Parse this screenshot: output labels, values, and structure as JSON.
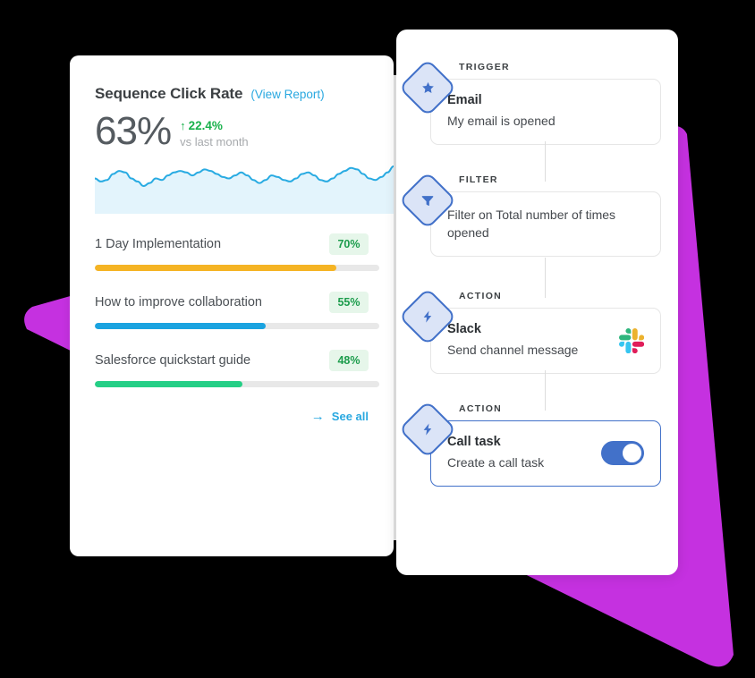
{
  "theme": {
    "background": "#000000",
    "accent_magenta": "#c531e0",
    "accent_blue": "#4271c9",
    "link_blue": "#29a8e0",
    "badge_green_text": "#1c9c4c",
    "badge_green_bg": "#e6f6ea",
    "delta_green": "#18b14b"
  },
  "metrics_card": {
    "title": "Sequence Click Rate",
    "view_report_label": "(View Report)",
    "kpi": {
      "value": "63%",
      "delta_arrow": "↑",
      "delta": "22.4%",
      "comparison": "vs last month"
    },
    "sparkline": {
      "line_color": "#29abe2",
      "fill_color": "#e3f4fc",
      "points": [
        62,
        58,
        60,
        68,
        72,
        70,
        62,
        58,
        52,
        56,
        62,
        60,
        66,
        70,
        72,
        70,
        66,
        70,
        74,
        72,
        68,
        64,
        62,
        66,
        70,
        66,
        60,
        56,
        60,
        66,
        64,
        60,
        58,
        62,
        68,
        70,
        66,
        60,
        58,
        62,
        68,
        72,
        76,
        74,
        68,
        62,
        60,
        64,
        70,
        78
      ]
    },
    "items": [
      {
        "label": "1 Day Implementation",
        "badge": "70%",
        "fill_percent": 85,
        "bar_color": "#f5b424"
      },
      {
        "label": "How to improve collaboration",
        "badge": "55%",
        "fill_percent": 60,
        "bar_color": "#1aa3e0"
      },
      {
        "label": "Salesforce quickstart guide",
        "badge": "48%",
        "fill_percent": 52,
        "bar_color": "#25cf86"
      }
    ],
    "see_all": {
      "arrow": "→",
      "label": "See all"
    }
  },
  "workflow_panel": {
    "nodes": [
      {
        "kicker": "TRIGGER",
        "icon": "star-icon",
        "title": "Email",
        "description": "My email is opened",
        "selected": false,
        "has_toggle": false,
        "has_slack_logo": false
      },
      {
        "kicker": "FILTER",
        "icon": "funnel-icon",
        "title": "",
        "description": "Filter on Total number of times opened",
        "selected": false,
        "has_toggle": false,
        "has_slack_logo": false
      },
      {
        "kicker": "ACTION",
        "icon": "bolt-icon",
        "title": "Slack",
        "description": "Send channel message",
        "selected": false,
        "has_toggle": false,
        "has_slack_logo": true
      },
      {
        "kicker": "ACTION",
        "icon": "bolt-icon",
        "title": "Call task",
        "description": "Create a call task",
        "selected": true,
        "has_toggle": true,
        "toggle_on": true,
        "has_slack_logo": false
      }
    ]
  }
}
